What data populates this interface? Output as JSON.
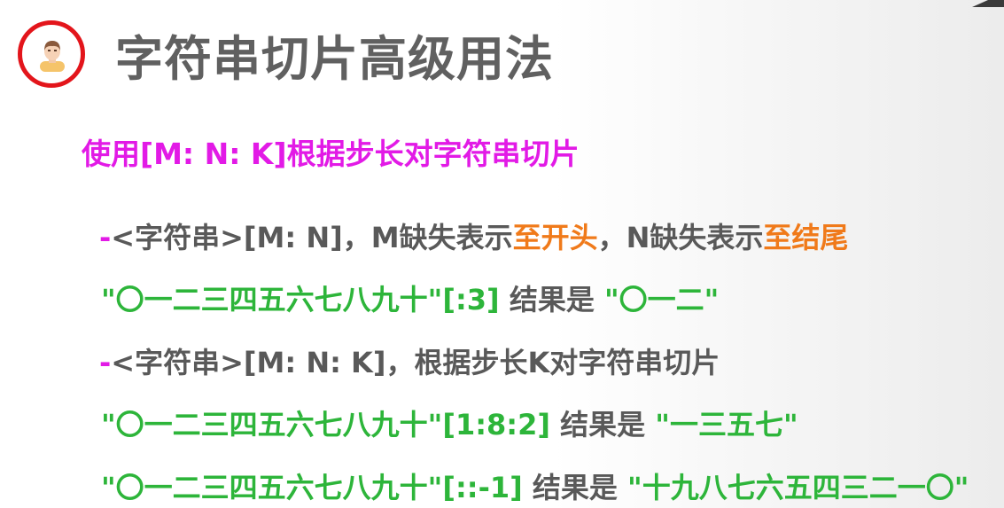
{
  "title": "字符串切片高级用法",
  "subtitle": "使用[M: N: K]根据步长对字符串切片",
  "line1": {
    "bullet": "-",
    "part1": "<字符串>[M: N]，M缺失表示",
    "hl1": "至开头",
    "part2": "，N缺失表示",
    "hl2": "至结尾"
  },
  "example1": {
    "code": "\"〇一二三四五六七八九十\"[:3]",
    "label": " 结果是 ",
    "result": " \"〇一二\""
  },
  "line2": {
    "bullet": "-",
    "text": "<字符串>[M: N: K]，根据步长K对字符串切片"
  },
  "example2": {
    "code": "\"〇一二三四五六七八九十\"[1:8:2]",
    "label": " 结果是 ",
    "result": " \"一三五七\""
  },
  "example3": {
    "code": "\"〇一二三四五六七八九十\"[::-1]",
    "label": " 结果是 ",
    "result": " \"十九八七六五四三二一〇\""
  },
  "colors": {
    "title": "#606060",
    "magenta": "#e21ae6",
    "orange": "#f07a1a",
    "green": "#2db53a",
    "avatar_ring": "#e3151b"
  }
}
